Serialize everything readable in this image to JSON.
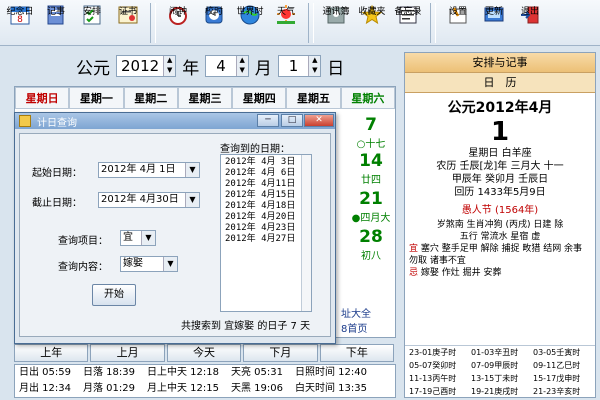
{
  "toolbar": {
    "buttons": [
      {
        "label": "纪念日",
        "icon": "calendar-page-icon"
      },
      {
        "label": "记事",
        "icon": "notebook-icon"
      },
      {
        "label": "安排",
        "icon": "checklist-icon"
      },
      {
        "label": "证书",
        "icon": "certificate-icon"
      },
      {
        "label": "闹钟",
        "icon": "alarm-clock-icon"
      },
      {
        "label": "校时",
        "icon": "sync-clock-icon"
      },
      {
        "label": "世界时",
        "icon": "globe-icon"
      },
      {
        "label": "天气",
        "icon": "weather-sun-icon"
      },
      {
        "label": "通讯簿",
        "icon": "address-book-icon"
      },
      {
        "label": "收藏夹",
        "icon": "star-icon"
      },
      {
        "label": "备忘录",
        "icon": "memo-icon"
      },
      {
        "label": "设置",
        "icon": "settings-icon"
      },
      {
        "label": "更新",
        "icon": "update-icon"
      },
      {
        "label": "退出",
        "icon": "exit-icon"
      }
    ]
  },
  "date_selector": {
    "prefix": "公元",
    "year": "2012",
    "year_unit": "年",
    "month": "4",
    "month_unit": "月",
    "day": "1",
    "day_unit": "日"
  },
  "calendar": {
    "weekdays": [
      "星期日",
      "星期一",
      "星期二",
      "星期三",
      "星期四",
      "星期五",
      "星期六"
    ],
    "visible_cells": [
      {
        "num": "7",
        "lunar": "○十七"
      },
      {
        "num": "14",
        "lunar": "廿四"
      },
      {
        "num": "21",
        "lunar": "●四月大"
      },
      {
        "num": "28",
        "lunar": "初八"
      }
    ],
    "links": [
      "址大全",
      "8首页"
    ],
    "nav": [
      "上年",
      "上月",
      "今天",
      "下月",
      "下年"
    ]
  },
  "info_panel": {
    "row1": [
      "日出 05:59",
      "日落 18:39",
      "日上中天 12:18",
      "天亮 05:31",
      "日照时间 12:40"
    ],
    "row2": [
      "月出 12:34",
      "月落 01:29",
      "月上中天 12:15",
      "天黑 19:06",
      "白天时间 13:35"
    ]
  },
  "dialog": {
    "title": "计日查询",
    "start_label": "起始日期：",
    "start_value": "2012年 4月 1日",
    "end_label": "截止日期：",
    "end_value": "2012年 4月30日",
    "item_label": "查询项目：",
    "item_value": "宜",
    "content_label": "查询内容：",
    "content_value": "嫁娶",
    "start_button": "开始",
    "results_label": "查询到的日期：",
    "results": [
      "2012年 4月 3日",
      "2012年 4月 6日",
      "2012年 4月11日",
      "2012年 4月15日",
      "2012年 4月18日",
      "2012年 4月20日",
      "2012年 4月23日",
      "2012年 4月27日"
    ],
    "summary": "共搜索到 宜嫁娶 的日子 7 天"
  },
  "right_panel": {
    "header": "安排与记事",
    "subheader": "日　历",
    "month_title": "公元2012年4月",
    "day": "1",
    "weekday": "星期日 白羊座",
    "lunar": "农历 壬辰[龙]年 三月大 十一",
    "ganzhi": "甲辰年 癸卯月 壬辰日",
    "hijri": "回历 1433年5月9日",
    "holiday": "愚人节 (1564年)",
    "lines": [
      "岁煞南 生肖冲狗 (丙戌) 日建 除",
      "五行 常流水 星宿 虚"
    ],
    "yi_tag": "宜",
    "yi": "塞穴 整手足甲 解除 捕捉 畋猎 结网 余事勿取 诸事不宜",
    "ji_tag": "忌",
    "ji": "嫁娶 作灶 掘井 安葬",
    "hours": [
      [
        "23-01庚子时",
        "01-03辛丑时",
        "03-05壬寅时"
      ],
      [
        "05-07癸卯时",
        "07-09甲辰时",
        "09-11乙巳时"
      ],
      [
        "11-13丙午时",
        "13-15丁未时",
        "15-17戊申时"
      ],
      [
        "17-19己酉时",
        "19-21庚戌时",
        "21-23辛亥时"
      ]
    ]
  }
}
